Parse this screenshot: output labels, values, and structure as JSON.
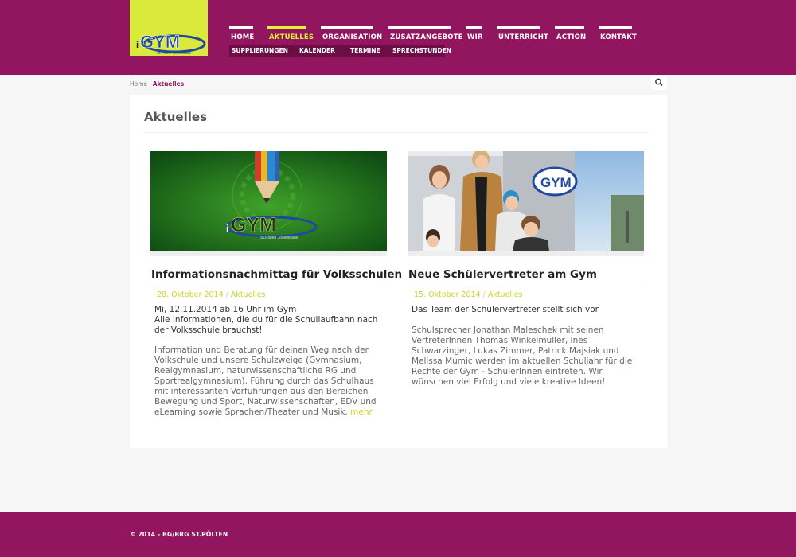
{
  "colors": {
    "brand": "#92155f",
    "accent": "#e4f035",
    "logo_bg": "#d9ea3b",
    "subnav_bg": "#6b0e45"
  },
  "logo": {
    "small_text": "i",
    "big_text": "GYM",
    "tagline": "St.Pölten Josefstraße"
  },
  "nav": {
    "items": [
      {
        "label": "HOME"
      },
      {
        "label": "AKTUELLES",
        "active": true
      },
      {
        "label": "ORGANISATION"
      },
      {
        "label": "ZUSATZANGEBOTE"
      },
      {
        "label": "WIR"
      },
      {
        "label": "UNTERRICHT"
      },
      {
        "label": "ACTION"
      },
      {
        "label": "KONTAKT"
      }
    ],
    "subitems": [
      {
        "label": "SUPPLIERUNGEN"
      },
      {
        "label": "KALENDER"
      },
      {
        "label": "TERMINE"
      },
      {
        "label": "SPRECHSTUNDEN"
      }
    ]
  },
  "breadcrumb": {
    "home": "Home",
    "separator": "|",
    "current": "Aktuelles"
  },
  "search": {
    "icon": "search-icon"
  },
  "page": {
    "title": "Aktuelles"
  },
  "articles": [
    {
      "title": "Informationsnachmittag für Volksschulen",
      "date": "28. Oktober 2014",
      "category": "Aktuelles",
      "lead_line1": "Mi, 12.11.2014 ab 16 Uhr im Gym",
      "lead_line2": "Alle Informationen, die du für die Schullaufbahn nach der Volksschule brauchst!",
      "body": "Information und Beratung für deinen Weg nach der Volk­schule und unsere Schulzweige (Gymnasium, Realgymnasi­um, naturwissenschaftliche RG und Sportrealgymnasium). Führung durch das Schulhaus mit interessanten Vorführungen aus den Bereichen Bewegung und Sport, Naturwissenschaften, EDV und eLearning sowie Sprachen/Theater und Musik.",
      "more": "mehr",
      "image": {
        "logo_small": "i",
        "logo_big": "GYM",
        "logo_tagline": "St.Pölten Josefstraße"
      }
    },
    {
      "title": "Neue Schülervertreter am Gym",
      "date": "15. Oktober 2014",
      "category": "Aktuelles",
      "lead_line1": "Das Team der Schülervertreter stellt sich vor",
      "lead_line2": "",
      "body": "Schulsprecher Jonathan Maleschek mit seinen VertreterIn­nen Thomas Winkelmüller, Ines Schwarzinger, Lukas Zimmer, Patrick Majsiak und Melissa Mumic werden im ak­tuellen Schuljahr für die Rechte der Gym - SchülerInnen eintreten. Wir wünschen viel Erfolg und viele kreative Ideen!",
      "more": "",
      "image": {
        "sign_text": "GYM"
      }
    }
  ],
  "footer": {
    "copyright": "© 2014 - BG/BRG ST.PÖLTEN"
  }
}
